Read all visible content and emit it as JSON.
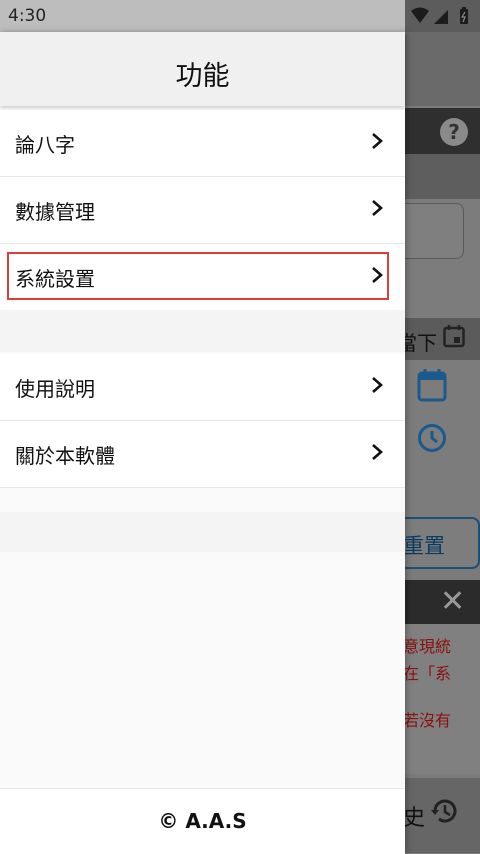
{
  "status_bar": {
    "time": "4:30"
  },
  "drawer": {
    "title": "功能",
    "group1": [
      {
        "label": "論八字"
      },
      {
        "label": "數據管理"
      },
      {
        "label": "系統設置"
      }
    ],
    "group2": [
      {
        "label": "使用說明"
      },
      {
        "label": "關於本軟體"
      }
    ],
    "footer": "© A.A.S"
  },
  "background": {
    "now_label": "當下",
    "reset_label": "重置",
    "alert_lines": [
      "意現統",
      "在「系",
      "若沒有"
    ],
    "bottom_text": "史"
  },
  "colors": {
    "highlight": "#e23b3b",
    "accent_blue": "#1a5a8c"
  },
  "icons": [
    "chevron-right-icon",
    "help-icon",
    "calendar-icon",
    "clock-icon",
    "close-icon",
    "history-icon",
    "wifi-icon",
    "signal-icon",
    "battery-icon"
  ]
}
